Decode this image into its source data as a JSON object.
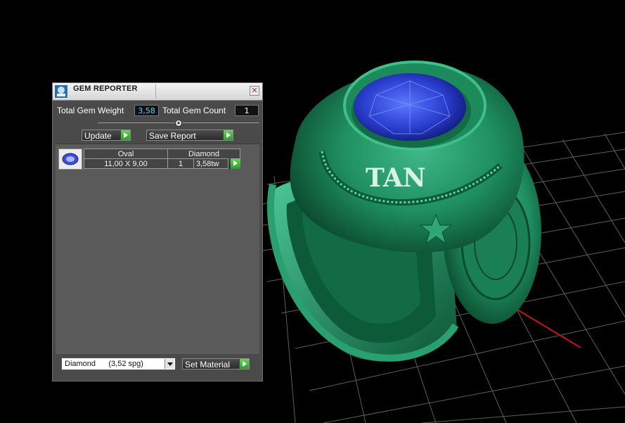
{
  "window": {
    "title": "GEM REPORTER",
    "app_icon": "gem-reporter-icon",
    "close_icon": "close-icon"
  },
  "summary": {
    "total_weight_label": "Total Gem Weight",
    "total_weight_value": "3,58",
    "total_count_label": "Total Gem Count",
    "total_count_value": "1",
    "slider_level": 0.5
  },
  "toolbar": {
    "update_label": "Update",
    "save_report_label": "Save Report"
  },
  "gems": [
    {
      "thumbnail_icon": "oval-gem-icon",
      "shape": "Oval",
      "material": "Diamond",
      "size": "11,00 X 9,00",
      "count": "1",
      "weight": "3,58tw"
    }
  ],
  "footer": {
    "material_select_value": "Diamond      (3,52 spg)",
    "set_material_label": "Set Material"
  },
  "viewport": {
    "ring_color": "#1f8f5f",
    "stone_color": "#2b3fd0",
    "ring_letters": "TAN",
    "grid_color": "#7a7a7a",
    "axis_color": "#c01818"
  }
}
